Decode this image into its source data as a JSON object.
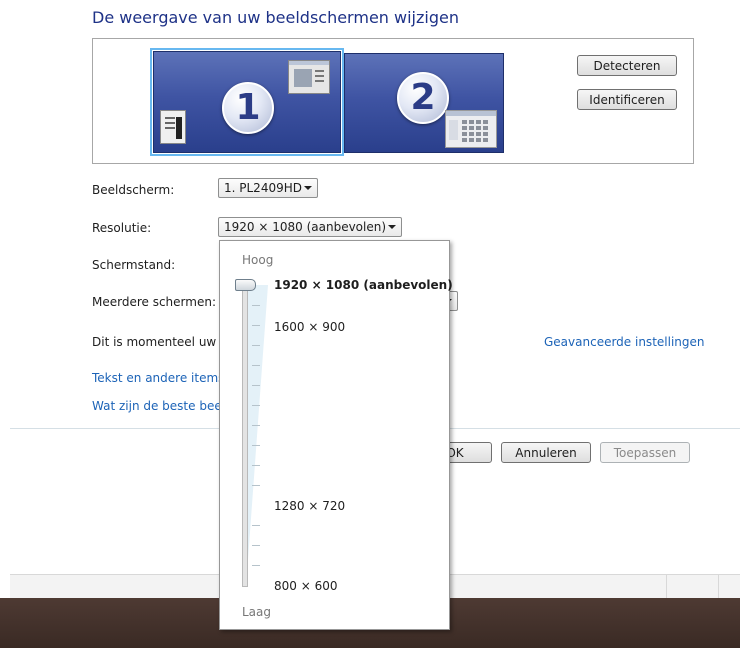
{
  "page_title": "De weergave van uw beeldschermen wijzigen",
  "monitors": [
    {
      "number": "1"
    },
    {
      "number": "2"
    }
  ],
  "buttons": {
    "detect": "Detecteren",
    "identify": "Identificeren",
    "ok": "OK",
    "cancel": "Annuleren",
    "apply": "Toepassen"
  },
  "fields": {
    "display_label": "Beeldscherm:",
    "display_value": "1. PL2409HD",
    "resolution_label": "Resolutie:",
    "resolution_value": "1920 × 1080 (aanbevolen)",
    "orientation_label": "Schermstand:",
    "multiple_label": "Meerdere schermen:"
  },
  "info_text": "Dit is momenteel uw h",
  "links": {
    "advanced": "Geavanceerde instellingen",
    "text_items": "Tekst en andere items",
    "best_settings": "Wat zijn de beste beeld"
  },
  "resolution_dropdown": {
    "high_label": "Hoog",
    "low_label": "Laag",
    "options": [
      {
        "label": "1920 × 1080 (aanbevolen)",
        "selected": true
      },
      {
        "label": "1600 × 900",
        "selected": false
      },
      {
        "label": "1280 × 720",
        "selected": false
      },
      {
        "label": "800 × 600",
        "selected": false
      }
    ]
  }
}
